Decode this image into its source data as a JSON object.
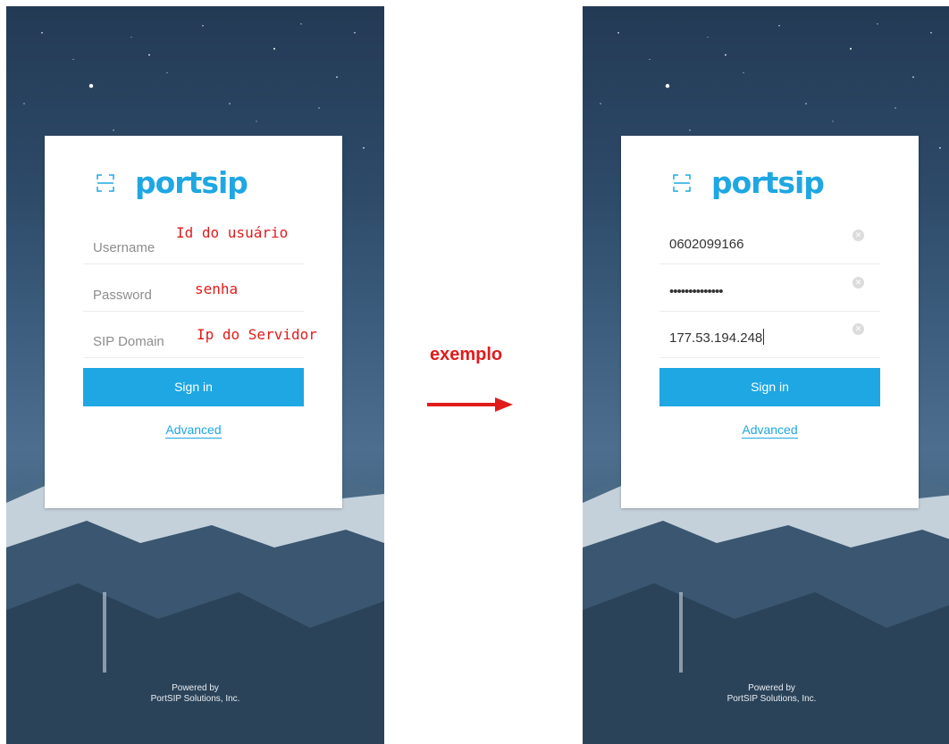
{
  "brand": {
    "name": "portsip",
    "color": "#1ea7e2"
  },
  "footer": {
    "line1": "Powered by",
    "line2": "PortSIP Solutions, Inc."
  },
  "left": {
    "username_placeholder": "Username",
    "password_placeholder": "Password",
    "domain_placeholder": "SIP Domain",
    "annotation_username": "Id do usuário",
    "annotation_password": "senha",
    "annotation_domain": "Ip do Servidor",
    "signin_label": "Sign in",
    "advanced_label": "Advanced"
  },
  "right": {
    "username_value": "0602099166",
    "password_value": "••••••••••••••",
    "domain_value": "177.53.194.248",
    "signin_label": "Sign in",
    "advanced_label": "Advanced"
  },
  "middle": {
    "label": "exemplo",
    "arrow_color": "#e01b1b"
  }
}
